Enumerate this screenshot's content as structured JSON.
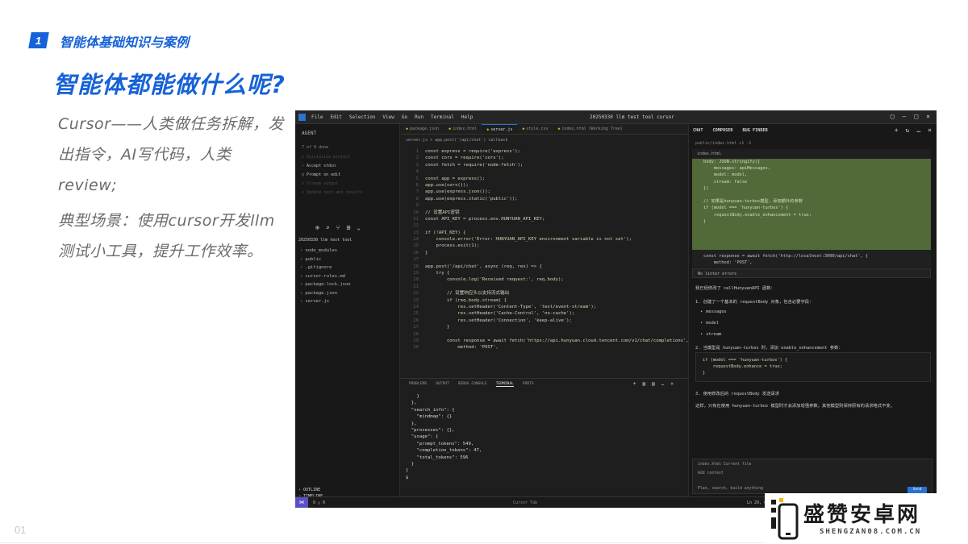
{
  "slide": {
    "section_num": "1",
    "section_title": "智能体基础知识与案例",
    "title": "智能体都能做什么呢?",
    "para1": "Cursor——人类做任务拆解，发出指令，AI写代码，人类review;",
    "para2": "典型场景：使用cursor开发llm测试小工具，提升工作效率。",
    "page_number": "01"
  },
  "watermark": {
    "logo_text": "盛赞安卓网",
    "url": "SHENGZAN08.COM.CN"
  },
  "colors": {
    "accent": "#1662d8",
    "body_text": "#6b6b6b",
    "ide_bg": "#1e1e1e",
    "diff_added": "#52693a"
  },
  "ide": {
    "menu": [
      "File",
      "Edit",
      "Selection",
      "View",
      "Go",
      "Run",
      "Terminal",
      "Help"
    ],
    "window_title": "20250330 llm test tool cursor",
    "sidebar": {
      "header": "AGENT",
      "sub": "7 of 9 done",
      "tasks": [
        {
          "label": "Initialize project",
          "state": "done"
        },
        {
          "label": "Accept stdin",
          "state": "active"
        },
        {
          "label": "Prompt on edit",
          "state": "pending"
        },
        {
          "label": "Stream output",
          "state": "done"
        },
        {
          "label": "Update test and results",
          "state": "done"
        }
      ],
      "project": "20250330 llm test tool",
      "files": [
        "node_modules",
        "public",
        ".gitignore",
        "cursor-rules.md",
        "package-lock.json",
        "package.json",
        "server.js"
      ],
      "outline": [
        "OUTLINE",
        "TIMELINE",
        "NPM SCRIPTS"
      ]
    },
    "tabs": [
      "package.json",
      "index.html",
      "server.js",
      "style.css",
      "index.html (Working Tree)"
    ],
    "breadcrumb": "server.js > app.post('/api/chat') callback",
    "code_lines": [
      "const express = require('express');",
      "const cors = require('cors');",
      "const fetch = require('node-fetch');",
      "",
      "const app = express();",
      "app.use(cors());",
      "app.use(express.json());",
      "app.use(express.static('public'));",
      "",
      "// 设置API密钥",
      "const API_KEY = process.env.HUNYUAN_API_KEY;",
      "",
      "if (!API_KEY) {",
      "    console.error('Error: HUNYUAN_API_KEY environment variable is not set');",
      "    process.exit(1);",
      "}",
      "",
      "app.post('/api/chat', async (req, res) => {",
      "    try {",
      "        console.log('Received request:', req.body);",
      "",
      "        // 设置响应头以支持流式输出",
      "        if (req.body.stream) {",
      "            res.setHeader('Content-Type', 'text/event-stream');",
      "            res.setHeader('Cache-Control', 'no-cache');",
      "            res.setHeader('Connection', 'keep-alive');",
      "        }",
      "",
      "        const response = await fetch('https://api.hunyuan.cloud.tencent.com/v1/chat/completions', {",
      "            method: 'POST',"
    ],
    "panel_tabs": [
      "PROBLEMS",
      "OUTPUT",
      "DEBUG CONSOLE",
      "TERMINAL",
      "PORTS"
    ],
    "terminal_lines": [
      "    }",
      "  },",
      "  \"search_info\": {",
      "    \"mindmap\": {}",
      "  },",
      "  \"processes\": {},",
      "  \"usage\": {",
      "    \"prompt_tokens\": 549,",
      "    \"completion_tokens\": 47,",
      "    \"total_tokens\": 596",
      "  }",
      "}",
      "$"
    ],
    "chat": {
      "tabs": [
        "CHAT",
        "COMPOSER",
        "BUG FINDER"
      ],
      "file_ref": "public/index.html +1 -1",
      "diff_file": "index.html",
      "diff_lines": [
        "body: JSON.stringify({",
        "    messages: apiMessages,",
        "    model: model,",
        "    stream: false",
        "})",
        "",
        "// 如果是hunyuan-turbos模型，添加额外的参数",
        "if (model === 'hunyuan-turbos') {",
        "    requestBody.enable_enhancement = true;",
        "}",
        "",
        "const response = await fetch('http://localhost:3000/api/chat', {",
        "    method: 'POST',"
      ],
      "resolved": "No linter errors",
      "msg1": "我已经修改了 callHunyuanAPI 函数：",
      "msg2": "1. 创建了一个基本的 requestBody 对象，包含必要字段：",
      "bullets": [
        "messages",
        "model",
        "stream"
      ],
      "msg3": "2. 当模型是 hunyuan-turbos 时，添加 enable_enhancement 参数：",
      "code_box": [
        "if (model === 'hunyuan-turbos') {",
        "    requestBody.enhance = true;",
        "}"
      ],
      "msg4": "3. 使用修改后的 requestBody 发送请求",
      "msg5": "这样，只有在使用 hunyuan-turbos 模型时才会添加增强参数，其他模型则保持原有的请求格式不变。",
      "input_lines": [
        "index.html  Current file",
        "Add context",
        "Plan, search, build anything"
      ],
      "send": "Send"
    },
    "status_left": "0 △ 0",
    "status_center": "Cursor Tab",
    "status_right": "Ln 29, Col 1   Spaces: 2   UTF-8   LF"
  }
}
